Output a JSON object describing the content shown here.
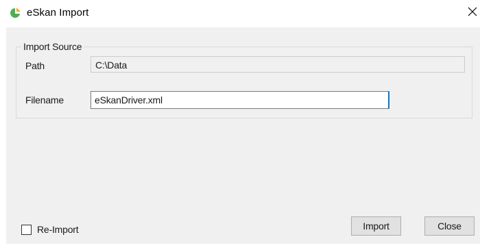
{
  "window": {
    "title": "eSkan Import",
    "icon": "eskan-app-icon",
    "close_icon": "close-icon",
    "accent_color": "#0078d7",
    "icon_color": "#4caf50"
  },
  "import_source": {
    "group_label": "Import Source",
    "path_label": "Path",
    "path_value": "C:\\Data",
    "filename_label": "Filename",
    "filename_value": "eSkanDriver.xml"
  },
  "options": {
    "reimport_label": "Re-Import",
    "reimport_checked": false
  },
  "buttons": {
    "import_label": "Import",
    "close_label": "Close"
  }
}
